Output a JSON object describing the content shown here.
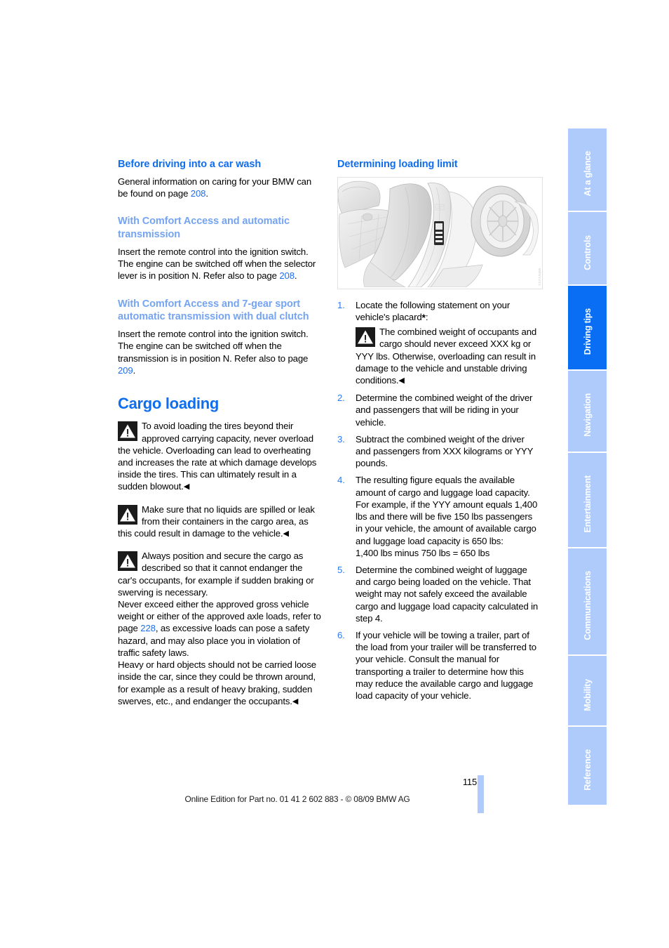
{
  "document": {
    "page_number": "115",
    "footer_credit": "Online Edition for Part no. 01 41 2 602 883 - © 08/09 BMW AG"
  },
  "colors": {
    "heading_blue": "#0f6df0",
    "subheading_blue": "#74a4f2",
    "tab_inactive": "#aecbfb",
    "tab_active": "#0a6ef5",
    "link_blue": "#1f6ef0"
  },
  "sidebar": {
    "tabs": [
      {
        "label": "At a glance",
        "active": false
      },
      {
        "label": "Controls",
        "active": false
      },
      {
        "label": "Driving tips",
        "active": true
      },
      {
        "label": "Navigation",
        "active": false
      },
      {
        "label": "Entertainment",
        "active": false
      },
      {
        "label": "Communications",
        "active": false
      },
      {
        "label": "Mobility",
        "active": false
      },
      {
        "label": "Reference",
        "active": false
      }
    ]
  },
  "left_column": {
    "section1": {
      "heading": "Before driving into a car wash",
      "paragraph_a": "General information on caring for your BMW can be found on page ",
      "page_ref_a": "208",
      "paragraph_a_end": "."
    },
    "section2": {
      "heading": "With Comfort Access and automatic transmission",
      "paragraph_a": "Insert the remote control into the ignition switch.",
      "paragraph_b": "The engine can be switched off when the selector lever is in position N. Refer also to page ",
      "page_ref_b": "208",
      "paragraph_b_end": "."
    },
    "section3": {
      "heading": "With Comfort Access and 7-gear sport automatic transmission with dual clutch",
      "paragraph_a": "Insert the remote control into the ignition switch.",
      "paragraph_b": "The engine can be switched off when the transmission is in position N. Refer also to page ",
      "page_ref_b": "209",
      "paragraph_b_end": "."
    },
    "cargo": {
      "heading": "Cargo loading",
      "warning1": "To avoid loading the tires beyond their approved carrying capacity, never overload the vehicle. Overloading can lead to overheating and increases the rate at which damage develops inside the tires. This can ultimately result in a sudden blowout.",
      "warning2": "Make sure that no liquids are spilled or leak from their containers in the cargo area, as this could result in damage to the vehicle.",
      "warning3": "Always position and secure the cargo as described so that it cannot endanger the car's occupants, for example if sudden braking or swerving is necessary.",
      "paragraph_never_exceed_a": "Never exceed either the approved gross vehicle weight or either of the approved axle loads, refer to page ",
      "page_ref_228": "228",
      "paragraph_never_exceed_b": ", as excessive loads can pose a safety hazard, and may also place you in violation of traffic safety laws.",
      "paragraph_heavy": "Heavy or hard objects should not be carried loose inside the car, since they could be thrown around, for example as a result of heavy braking, sudden swerves, etc., and endanger the occupants.",
      "end_mark": "◀"
    }
  },
  "right_column": {
    "heading": "Determining loading limit",
    "illustration": {
      "caption_code": "BMW1US1",
      "alt": "Car seat and open door showing location of the loading limit placard on the door pillar"
    },
    "steps": [
      {
        "num": "1.",
        "text_before_warning": "Locate the following statement on your vehicle's placard",
        "asterisk": "*",
        "colon": ":",
        "warning": "The combined weight of occupants and cargo should never exceed XXX kg or YYY lbs. Otherwise, overloading can result in damage to the vehicle and unstable driving conditions.",
        "end_mark": "◀"
      },
      {
        "num": "2.",
        "text": "Determine the combined weight of the driver and passengers that will be riding in your vehicle."
      },
      {
        "num": "3.",
        "text": "Subtract the combined weight of the driver and passengers from XXX kilograms or YYY pounds."
      },
      {
        "num": "4.",
        "text": "The resulting figure equals the available amount of cargo and luggage load capacity. For example, if the YYY amount equals 1,400 lbs and there will be five 150 lbs passengers in your vehicle, the amount of available cargo and luggage load capacity is 650 lbs:",
        "equation": "1,400 lbs minus 750 lbs = 650 lbs"
      },
      {
        "num": "5.",
        "text": "Determine the combined weight of luggage and cargo being loaded on the vehicle. That weight may not safely exceed the available cargo and luggage load capacity calculated in step 4."
      },
      {
        "num": "6.",
        "text": "If your vehicle will be towing a trailer, part of the load from your trailer will be transferred to your vehicle. Consult the manual for transporting a trailer to determine how this may reduce the available cargo and luggage load capacity of your vehicle."
      }
    ]
  }
}
